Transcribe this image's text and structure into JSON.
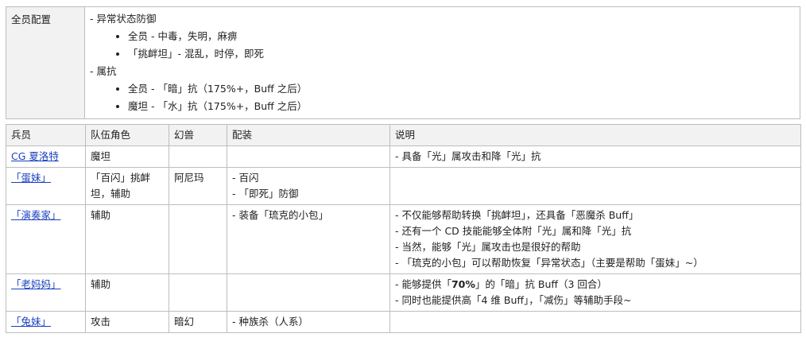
{
  "config": {
    "label": "全员配置",
    "sections": [
      {
        "title": "- 异常状态防御",
        "items": [
          "全员 - 中毒，失明，麻痹",
          "「挑衅坦」- 混乱，时停，即死"
        ]
      },
      {
        "title": "- 属抗",
        "items": [
          "全员 - 「暗」抗（175%+，Buff 之后）",
          "魔坦 - 「水」抗（175%+，Buff 之后）"
        ]
      }
    ]
  },
  "table": {
    "headers": [
      "兵员",
      "队伍角色",
      "幻兽",
      "配装",
      "说明"
    ],
    "rows": [
      {
        "name": "CG 夏洛特",
        "role": [
          "魔坦"
        ],
        "beast": "",
        "gear": [],
        "notes": [
          "- 具备「光」属攻击和降「光」抗"
        ]
      },
      {
        "name": "「蛋妹」",
        "role": [
          "「百闪」挑衅",
          "坦，辅助"
        ],
        "beast": "阿尼玛",
        "gear": [
          "- 百闪",
          "- 「即死」防御"
        ],
        "notes": []
      },
      {
        "name": "「演奏家」",
        "role": [
          "辅助"
        ],
        "beast": "",
        "gear": [
          "- 装备「琉克的小包」"
        ],
        "notes": [
          "- 不仅能够帮助转换「挑衅坦」，还具备「恶魔杀 Buff」",
          "- 还有一个 CD 技能能够全体附「光」属和降「光」抗",
          "- 当然，能够「光」属攻击也是很好的帮助",
          "- 「琉克的小包」可以帮助恢复「异常状态」（主要是帮助「蛋妹」~）"
        ]
      },
      {
        "name": "「老妈妈」",
        "role": [
          "辅助"
        ],
        "beast": "",
        "gear": [],
        "notes_rich": [
          {
            "pre": "- 能够提供「",
            "bold": "70%",
            "post": "」的「暗」抗 Buff（3 回合）"
          }
        ],
        "notes": [
          "- 同时也能提供高「4 维 Buff」，「减伤」等辅助手段~"
        ]
      },
      {
        "name": "「兔妹」",
        "role": [
          "攻击"
        ],
        "beast": "暗幻",
        "gear": [
          "- 种族杀（人系）"
        ],
        "notes": []
      }
    ]
  }
}
